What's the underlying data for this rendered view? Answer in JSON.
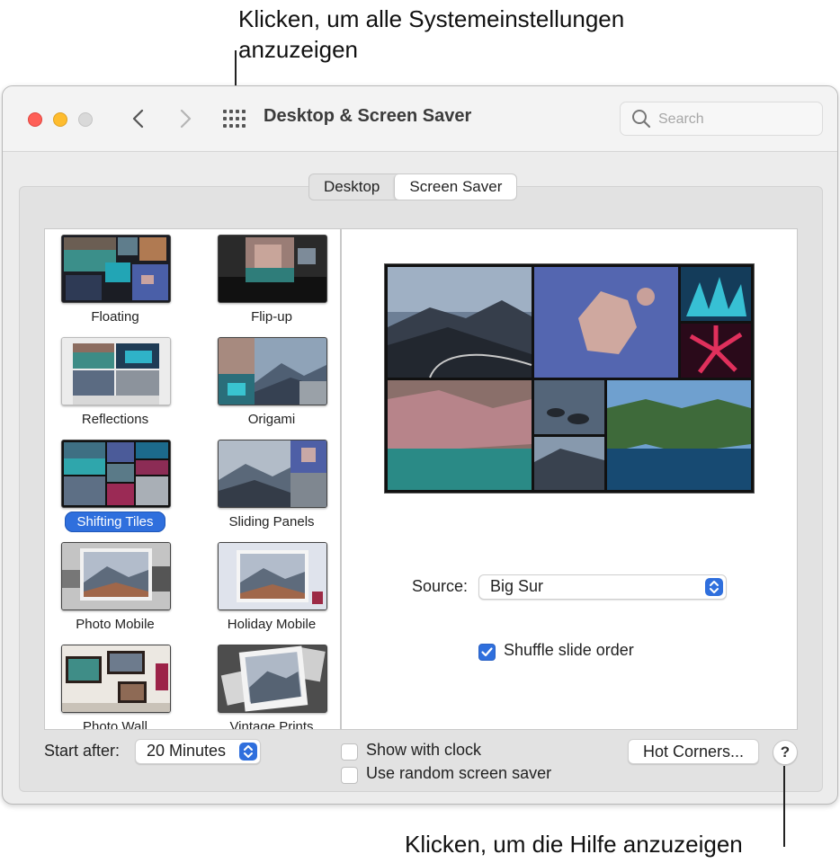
{
  "callouts": {
    "top": "Klicken, um alle Systemeinstellungen anzuzeigen",
    "bottom": "Klicken, um die Hilfe anzuzeigen"
  },
  "window": {
    "title": "Desktop & Screen Saver",
    "search_placeholder": "Search"
  },
  "tabs": [
    {
      "label": "Desktop",
      "selected": false
    },
    {
      "label": "Screen Saver",
      "selected": true
    }
  ],
  "screen_savers": [
    {
      "label": "Floating",
      "selected": false
    },
    {
      "label": "Flip-up",
      "selected": false
    },
    {
      "label": "Reflections",
      "selected": false
    },
    {
      "label": "Origami",
      "selected": false
    },
    {
      "label": "Shifting Tiles",
      "selected": true
    },
    {
      "label": "Sliding Panels",
      "selected": false
    },
    {
      "label": "Photo Mobile",
      "selected": false
    },
    {
      "label": "Holiday Mobile",
      "selected": false
    },
    {
      "label": "Photo Wall",
      "selected": false
    },
    {
      "label": "Vintage Prints",
      "selected": false
    }
  ],
  "options": {
    "source_label": "Source:",
    "source_value": "Big Sur",
    "shuffle_label": "Shuffle slide order",
    "shuffle_checked": true
  },
  "footer": {
    "start_after_label": "Start after:",
    "start_after_value": "20 Minutes",
    "show_clock_label": "Show with clock",
    "show_clock_checked": false,
    "random_label": "Use random screen saver",
    "random_checked": false,
    "hot_corners_label": "Hot Corners...",
    "help_label": "?"
  },
  "colors": {
    "accent": "#2f6fdd",
    "close": "#fe5f57",
    "minimize": "#febc2e",
    "zoom_inactive": "#d9d9d9"
  }
}
